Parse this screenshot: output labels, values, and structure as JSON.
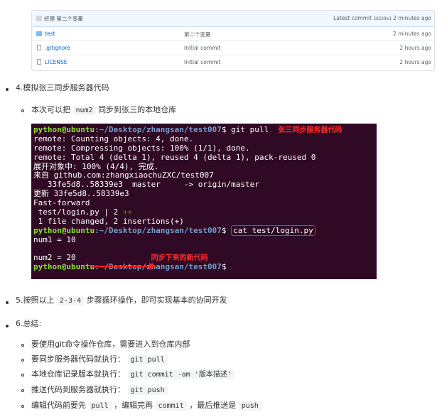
{
  "repo": {
    "commit_message": "经理 第二个变量",
    "latest_commit_label": "Latest commit",
    "latest_commit_sha": "58339e3",
    "latest_commit_time": "2 minutes ago",
    "files": [
      {
        "icon": "folder-icon",
        "name": "test",
        "message": "第二个变量",
        "age": "2 minutes ago"
      },
      {
        "icon": "file-icon",
        "name": ".gitignore",
        "message": "Initial commit",
        "age": "2 hours ago"
      },
      {
        "icon": "file-icon",
        "name": "LICENSE",
        "message": "Initial commit",
        "age": "2 hours ago"
      }
    ]
  },
  "step4": {
    "title": "4.模拟张三同步服务器代码",
    "sub_prefix": "本次可以把",
    "sub_code": "num2",
    "sub_suffix": "同步到张三的本地仓库"
  },
  "terminal": {
    "prompt_user": "python@ubuntu",
    "prompt_path": ":~/Desktop/zhangsan/test007",
    "cmd1": "$ git pull",
    "anno1": "张三同步服务器代码",
    "lines": [
      "remote: Counting objects: 4, done.",
      "remote: Compressing objects: 100% (1/1), done.",
      "remote: Total 4 (delta 1), reused 4 (delta 1), pack-reused 0",
      "展开对象中: 100% (4/4), 完成.",
      "来自 github.com:zhangxiaochuZXC/test007",
      "   33fe5d8..58339e3  master     -> origin/master",
      "更新 33fe5d8..58339e3",
      "Fast-forward"
    ],
    "stat_file": " test/login.py | 2 ",
    "stat_plus": "++",
    "stat_summary": " 1 file changed, 2 insertions(+)",
    "cmd2_prefix": "$ ",
    "cmd2": "cat test/login.py",
    "out1": "num1 = 10",
    "out2": "num2 = 20",
    "anno2": "同步下来的新代码",
    "prompt_end": "$"
  },
  "step5": {
    "prefix": "5.按照以上",
    "code": "2-3-4",
    "suffix": "步骤循环操作，即可实现基本的协同开发"
  },
  "step6": {
    "title": "6.总结:",
    "items": [
      {
        "text": "要使用git命令操作仓库，需要进入到仓库内部",
        "code": ""
      },
      {
        "text": "要同步服务器代码就执行：",
        "code": "git pull"
      },
      {
        "text": "本地仓库记录版本就执行：",
        "code": "git commit -am '版本描述'"
      },
      {
        "text": "推送代码到服务器就执行：",
        "code": "git push"
      }
    ],
    "last": {
      "t1": "编辑代码前要先",
      "c1": "pull",
      "t2": "，编辑完再",
      "c2": "commit",
      "t3": "，最后推送是",
      "c3": "push"
    }
  }
}
